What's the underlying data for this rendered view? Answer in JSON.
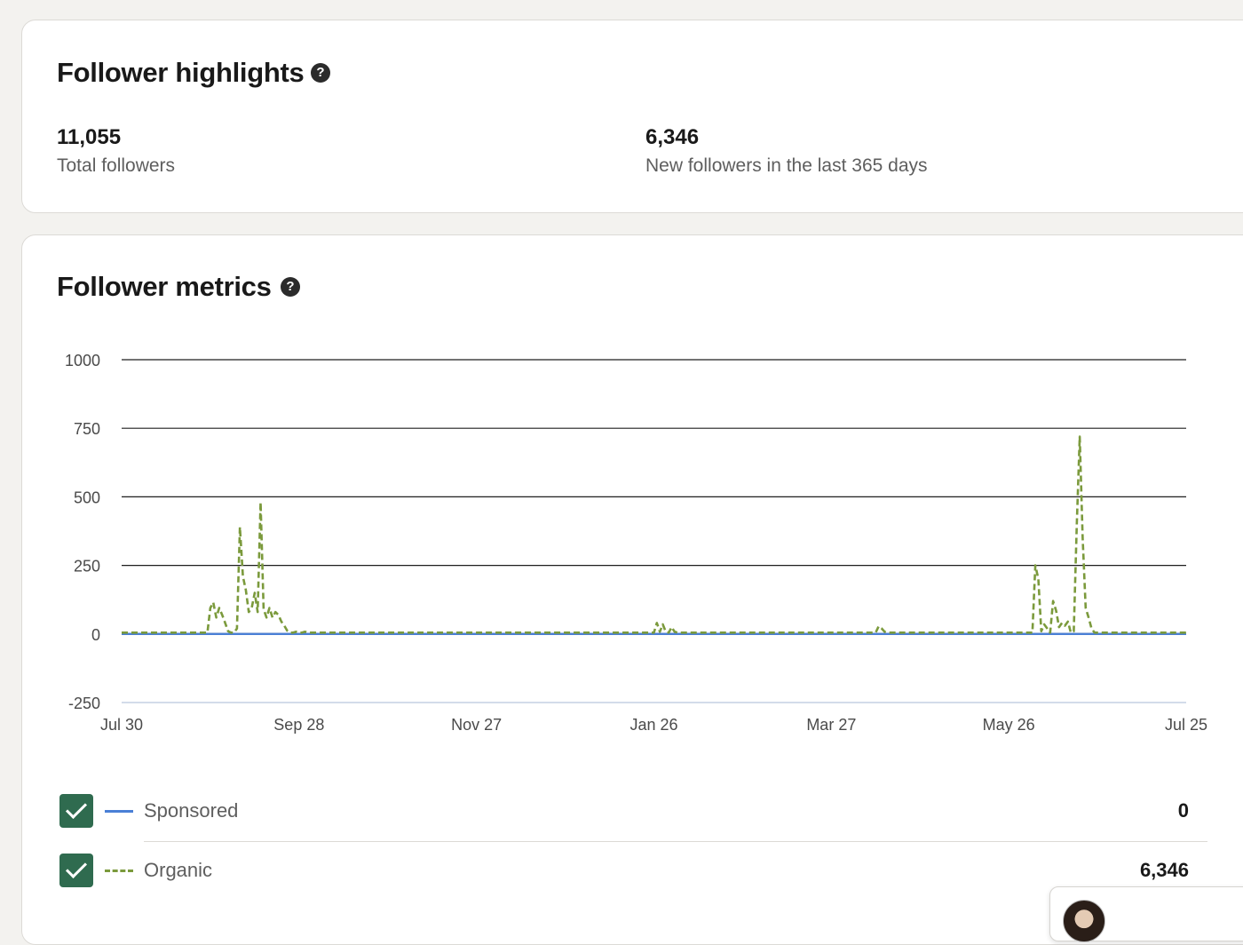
{
  "highlights": {
    "title": "Follower highlights",
    "help_icon": "question-mark-circle-icon",
    "stats": [
      {
        "value": "11,055",
        "label": "Total followers"
      },
      {
        "value": "6,346",
        "label": "New followers in the last 365 days"
      }
    ]
  },
  "metrics": {
    "title": "Follower metrics",
    "help_icon": "question-mark-circle-icon",
    "legend": [
      {
        "label": "Sponsored",
        "value": "0",
        "checked": true,
        "color": "#4a7fd6",
        "line_style": "solid"
      },
      {
        "label": "Organic",
        "value": "6,346",
        "checked": true,
        "color": "#7b9a3c",
        "line_style": "dashed"
      }
    ]
  },
  "chart_data": {
    "type": "line",
    "title": "",
    "xlabel": "",
    "ylabel": "",
    "ylim": [
      -250,
      1000
    ],
    "yticks": [
      1000,
      750,
      500,
      250,
      0,
      -250
    ],
    "xticks": [
      "Jul 30",
      "Sep 28",
      "Nov 27",
      "Jan 26",
      "Mar 27",
      "May 26",
      "Jul 25"
    ],
    "x_range_days": [
      0,
      360
    ],
    "grid": true,
    "series": [
      {
        "name": "Sponsored",
        "color": "#4a7fd6",
        "style": "solid",
        "x": [
          0,
          360
        ],
        "values": [
          0,
          0
        ]
      },
      {
        "name": "Organic",
        "color": "#7b9a3c",
        "style": "dashed",
        "x": [
          0,
          29,
          30,
          31,
          32,
          33,
          34,
          35,
          36,
          37,
          38,
          39,
          40,
          41,
          42,
          43,
          44,
          45,
          46,
          47,
          48,
          49,
          50,
          51,
          52,
          53,
          54,
          55,
          56,
          57,
          58,
          59,
          60,
          61,
          62,
          63,
          64,
          180,
          181,
          182,
          183,
          184,
          185,
          186,
          187,
          188,
          255,
          256,
          257,
          258,
          259,
          308,
          309,
          310,
          311,
          312,
          313,
          314,
          315,
          316,
          317,
          318,
          319,
          320,
          321,
          322,
          323,
          324,
          325,
          326,
          327,
          328,
          329,
          330,
          331,
          360
        ],
        "values": [
          5,
          5,
          95,
          115,
          60,
          95,
          70,
          40,
          10,
          5,
          5,
          20,
          390,
          210,
          160,
          80,
          95,
          150,
          80,
          480,
          90,
          60,
          95,
          60,
          80,
          70,
          45,
          30,
          12,
          5,
          5,
          8,
          5,
          5,
          8,
          5,
          5,
          5,
          40,
          8,
          35,
          8,
          5,
          25,
          8,
          5,
          5,
          28,
          20,
          8,
          5,
          5,
          250,
          200,
          10,
          35,
          20,
          5,
          120,
          85,
          25,
          40,
          30,
          45,
          5,
          10,
          400,
          720,
          350,
          95,
          60,
          20,
          5,
          5,
          5,
          5
        ]
      }
    ]
  }
}
